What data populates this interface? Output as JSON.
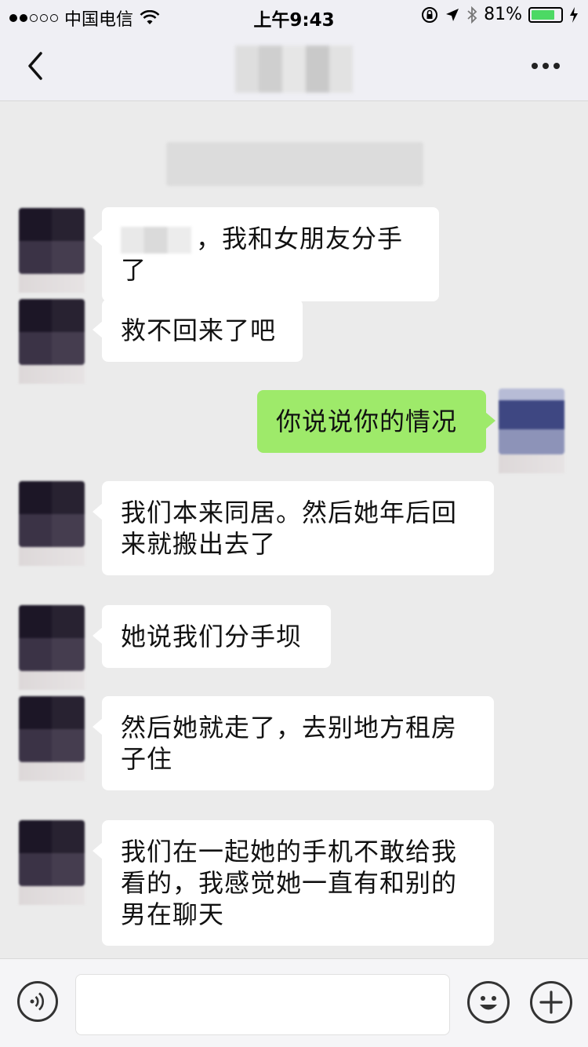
{
  "status_bar": {
    "carrier": "中国电信",
    "time": "上午9:43",
    "battery_text": "81%",
    "battery_level": 0.81,
    "signal_bars": 2,
    "signal_total": 5
  },
  "nav": {
    "back_icon": "chevron-left-icon",
    "more_icon": "more-dots-icon"
  },
  "chat": {
    "clipped_notice": "",
    "timestamp": "",
    "messages": [
      {
        "side": "in",
        "text": "，我和女朋友分手了",
        "has_redaction": true
      },
      {
        "side": "in",
        "text": "救不回来了吧"
      },
      {
        "side": "out",
        "text": "你说说你的情况"
      },
      {
        "side": "in",
        "text": "我们本来同居。然后她年后回来就搬出去了"
      },
      {
        "side": "in",
        "text": "她说我们分手坝"
      },
      {
        "side": "in",
        "text": "然后她就走了，去别地方租房子住"
      },
      {
        "side": "in",
        "text": "我们在一起她的手机不敢给我看的，我感觉她一直有和别的男在聊天"
      }
    ]
  },
  "toolbar": {
    "voice_icon": "voice-icon",
    "input_value": "",
    "emoji_icon": "emoji-icon",
    "add_icon": "plus-icon"
  },
  "colors": {
    "chat_background": "#ebebeb",
    "incoming_bubble": "#ffffff",
    "outgoing_bubble": "#9eea6a",
    "battery_fill": "#4cd964"
  }
}
